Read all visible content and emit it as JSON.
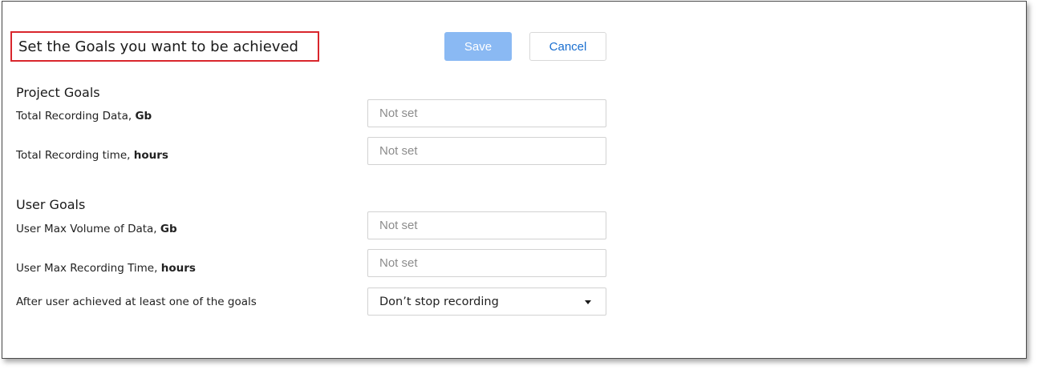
{
  "header": {
    "title": "Set the Goals you want to be achieved",
    "save_label": "Save",
    "cancel_label": "Cancel"
  },
  "project_goals": {
    "title": "Project Goals",
    "fields": [
      {
        "label": "Total Recording Data, ",
        "unit": "Gb",
        "value": "",
        "placeholder": "Not set"
      },
      {
        "label": "Total Recording time, ",
        "unit": "hours",
        "value": "",
        "placeholder": "Not set"
      }
    ]
  },
  "user_goals": {
    "title": "User Goals",
    "fields": [
      {
        "label": "User Max Volume of Data, ",
        "unit": "Gb",
        "value": "",
        "placeholder": "Not set"
      },
      {
        "label": "User Max Recording Time, ",
        "unit": "hours",
        "value": "",
        "placeholder": "Not set"
      }
    ],
    "after_goal": {
      "label": "After user achieved at least one of the goals",
      "selected": "Don’t stop recording"
    }
  },
  "icons": {
    "dropdown": "chevron-down-icon"
  },
  "colors": {
    "title_border": "#d9262c",
    "save_button": "#8ab9f3",
    "cancel_text": "#1a6fd0"
  }
}
